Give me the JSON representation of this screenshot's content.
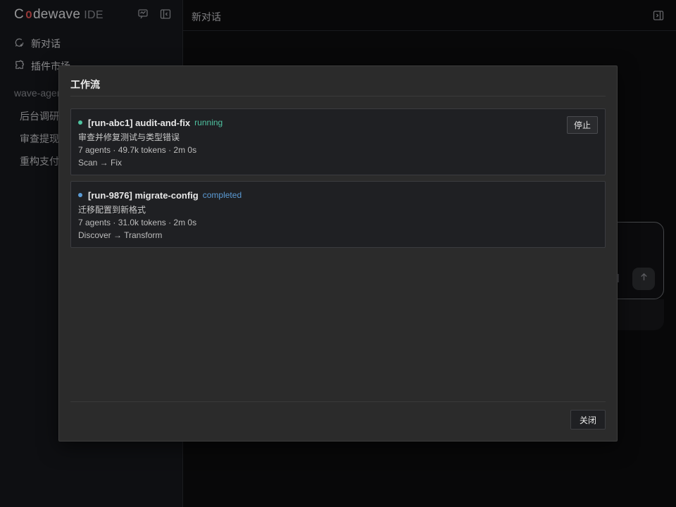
{
  "sidebar": {
    "brand": {
      "prefix": "C",
      "accent": "o",
      "rest": "dewave",
      "suffix": "IDE"
    },
    "icons": [
      "chat-bubble-icon",
      "sidebar-toggle-icon"
    ],
    "nav": [
      {
        "label": "新对话",
        "icon": "new-chat-icon"
      },
      {
        "label": "插件市场",
        "icon": "puzzle-icon"
      }
    ],
    "section_label": "wave-agent",
    "conversations": [
      "后台调研",
      "审查提现",
      "重构支付"
    ]
  },
  "main": {
    "title": "新对话",
    "toggle_icon": "sidebar-toggle-icon",
    "send_icon": "arrow-up-icon"
  },
  "modal": {
    "title": "工作流",
    "workflows": [
      {
        "name": "[run-abc1] audit-and-fix",
        "status": "running",
        "status_color": "#4fc3a1",
        "dot_color": "#4fc3a1",
        "description": "审查并修复测试与类型错误",
        "meta": "7 agents · 49.7k tokens · 2m 0s",
        "steps": "Scan → Fix",
        "action_label": "停止"
      },
      {
        "name": "[run-9876] migrate-config",
        "status": "completed",
        "status_color": "#5b9bd5",
        "dot_color": "#5b9bd5",
        "description": "迁移配置到新格式",
        "meta": "7 agents · 31.0k tokens · 2m 0s",
        "steps": "Discover → Transform"
      }
    ],
    "close_label": "关闭"
  },
  "colors": {
    "brand_accent": "#e25555",
    "running": "#4fc3a1",
    "completed": "#5b9bd5"
  }
}
